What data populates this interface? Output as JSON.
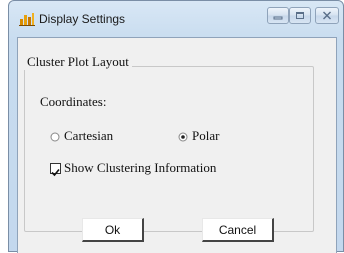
{
  "window": {
    "title": "Display Settings",
    "icon": "app-chart-icon",
    "controls": [
      "minimize-icon",
      "maximize-icon",
      "close-icon"
    ]
  },
  "group": {
    "legend": "Cluster Plot Layout",
    "coordinates_label": "Coordinates:",
    "options": [
      {
        "label": "Cartesian",
        "selected": false
      },
      {
        "label": "Polar",
        "selected": true
      }
    ],
    "show_info": {
      "label": "Show Clustering Information",
      "checked": true
    }
  },
  "buttons": {
    "ok": "Ok",
    "cancel": "Cancel"
  }
}
